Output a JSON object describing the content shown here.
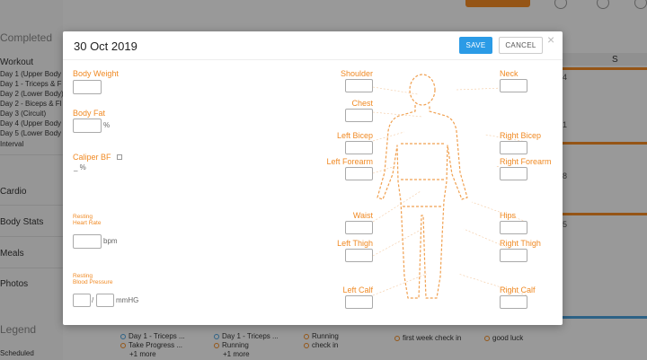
{
  "background": {
    "sidebar": {
      "completed_heading": "Completed",
      "workout_label": "Workout",
      "workouts": [
        "Day 1 (Upper Body",
        "Day 1 - Triceps & F",
        "Day 2 (Lower Body)",
        "Day 2 - Biceps & Fl",
        "Day 3 (Circuit)",
        "Day 4 (Upper Body",
        "Day 5 (Lower Body",
        "Interval"
      ],
      "cardio_label": "Cardio",
      "body_stats_label": "Body Stats",
      "meals_label": "Meals",
      "photos_label": "Photos",
      "legend_heading": "Legend",
      "scheduled_label": "Scheduled"
    },
    "calendar": {
      "day_header": "S",
      "day_numbers": [
        "4",
        "1",
        "8",
        "5"
      ]
    },
    "events": [
      {
        "lines": [
          "Day 1 - Triceps ...",
          "Take Progress ...",
          "+1 more"
        ]
      },
      {
        "lines": [
          "Day 1 - Triceps ...",
          "Running",
          "+1 more"
        ]
      },
      {
        "lines": [
          "Running",
          "check in"
        ]
      },
      {
        "lines": [
          "first week check in"
        ]
      },
      {
        "lines": [
          "good luck"
        ]
      }
    ]
  },
  "modal": {
    "title": "30 Oct 2019",
    "save_label": "SAVE",
    "cancel_label": "CANCEL",
    "close_glyph": "×",
    "left_fields": {
      "body_weight": "Body Weight",
      "body_fat": "Body Fat",
      "body_fat_unit": "%",
      "caliper_bf": "Caliper BF",
      "caliper_unit": "_ %",
      "resting_hr_line1": "Resting",
      "resting_hr_line2": "Heart Rate",
      "resting_hr_unit": "bpm",
      "resting_bp_line1": "Resting",
      "resting_bp_line2": "Blood Pressure",
      "bp_separator": "/",
      "bp_unit": "mmHG"
    },
    "body_fields": {
      "shoulder": "Shoulder",
      "neck": "Neck",
      "chest": "Chest",
      "left_bicep": "Left Bicep",
      "right_bicep": "Right Bicep",
      "left_forearm": "Left Forearm",
      "right_forearm": "Right Forearm",
      "waist": "Waist",
      "hips": "Hips",
      "left_thigh": "Left Thigh",
      "right_thigh": "Right Thigh",
      "left_calf": "Left Calf",
      "right_calf": "Right Calf"
    }
  },
  "colors": {
    "accent_orange": "#f08a24",
    "save_blue": "#2b9be6"
  }
}
